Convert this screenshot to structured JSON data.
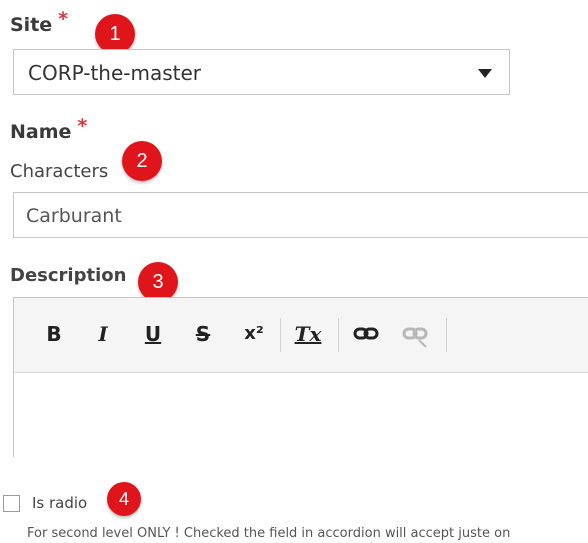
{
  "site": {
    "label": "Site",
    "required_marker": "*",
    "selected_value": "CORP-the-master"
  },
  "name": {
    "label": "Name",
    "required_marker": "*",
    "sublabel": "Characters",
    "value": "Carburant"
  },
  "description": {
    "label": "Description",
    "toolbar": {
      "bold": "B",
      "italic": "I",
      "underline": "U",
      "strike": "S",
      "superscript": "x²",
      "clear_format": "Tx"
    }
  },
  "is_radio": {
    "label": "Is radio",
    "checked": false,
    "help_text": "For second level ONLY ! Checked the field in accordion will accept juste on"
  },
  "badges": [
    "1",
    "2",
    "3",
    "4"
  ],
  "colors": {
    "badge": "#e0141b",
    "required": "#d9363e"
  }
}
